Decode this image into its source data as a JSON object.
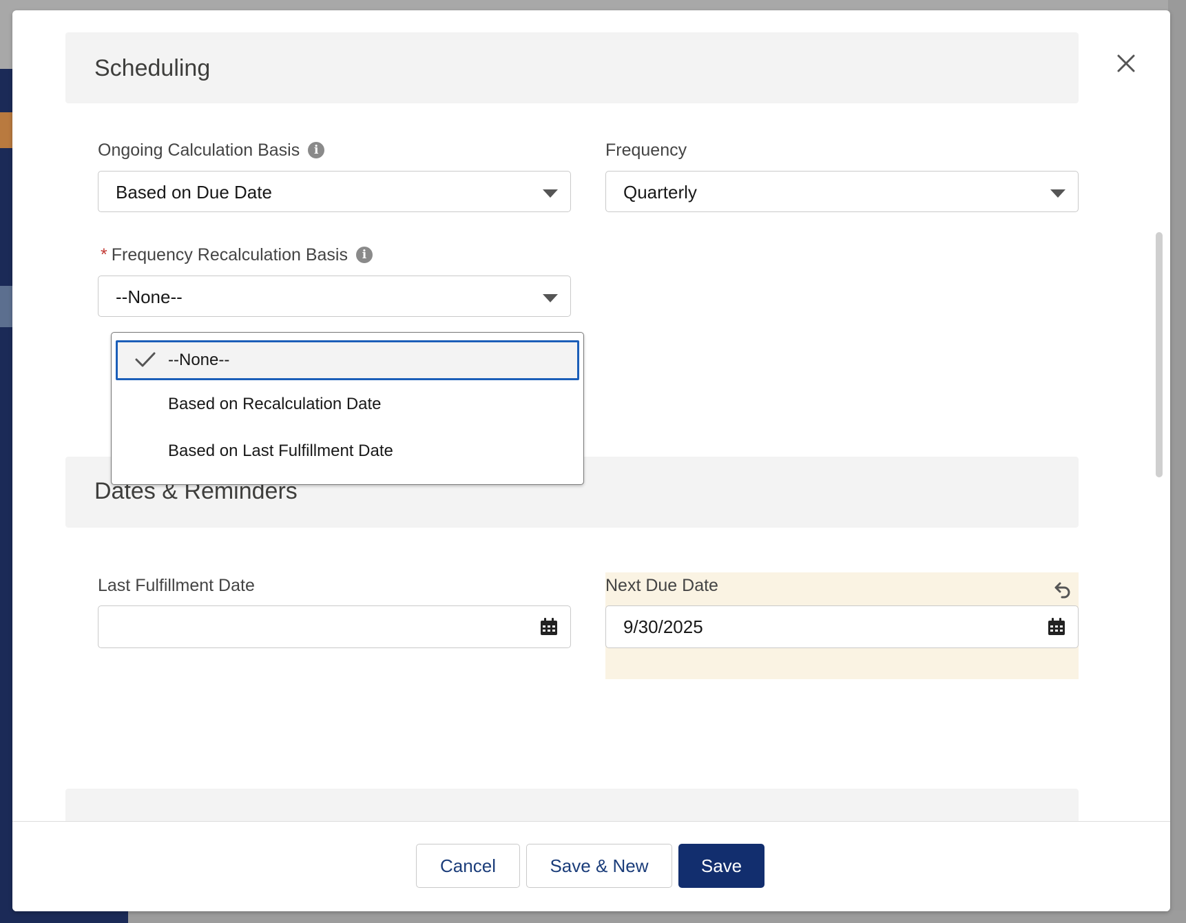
{
  "modal": {
    "close_icon": "close-icon"
  },
  "sections": {
    "scheduling": {
      "title": "Scheduling"
    },
    "dates_reminders": {
      "title": "Dates & Reminders"
    }
  },
  "fields": {
    "ongoing_calculation_basis": {
      "label": "Ongoing Calculation Basis",
      "value": "Based on Due Date"
    },
    "frequency": {
      "label": "Frequency",
      "value": "Quarterly"
    },
    "frequency_recalculation_basis": {
      "required_mark": "*",
      "label": "Frequency Recalculation Basis",
      "value": "--None--",
      "options": [
        "--None--",
        "Based on Recalculation Date",
        "Based on Last Fulfillment Date"
      ],
      "selected_index": 0
    },
    "last_fulfillment_date": {
      "label": "Last Fulfillment Date",
      "value": ""
    },
    "next_due_date": {
      "label": "Next Due Date",
      "value": "9/30/2025"
    }
  },
  "footer": {
    "cancel_label": "Cancel",
    "save_new_label": "Save & New",
    "save_label": "Save"
  },
  "colors": {
    "brand": "#122e6e",
    "focus": "#1b5eb8",
    "changed_highlight": "#faf3e3",
    "required": "#c23934"
  }
}
